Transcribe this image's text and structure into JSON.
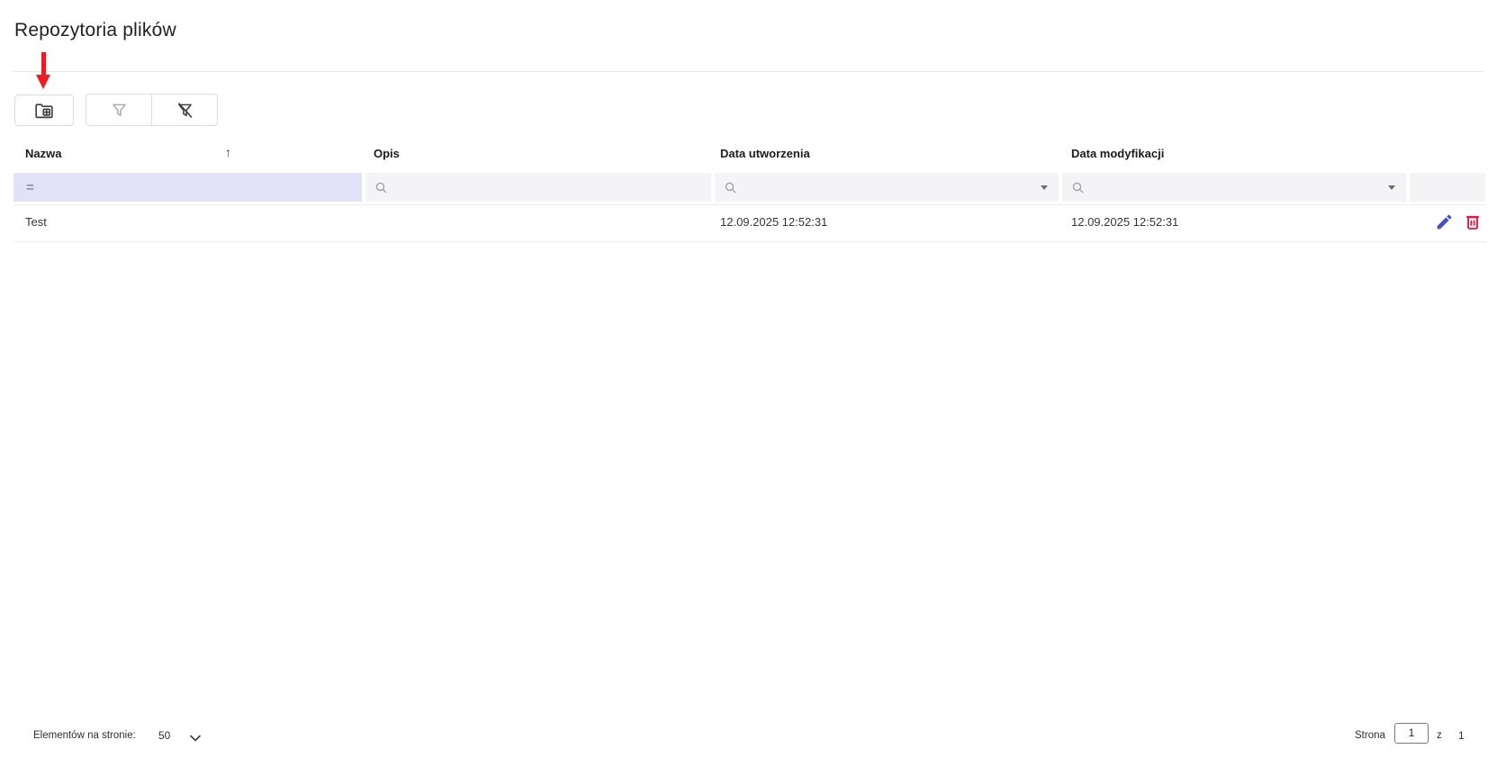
{
  "page": {
    "title": "Repozytoria plików"
  },
  "annotation": {
    "arrow_color": "#ec1c24",
    "arrow_points_to": "add-repository-button"
  },
  "toolbar": {
    "add_button_icon": "folder-plus",
    "filter_button_icon": "filter-funnel",
    "clear_filter_button_icon": "filter-funnel-off"
  },
  "table": {
    "columns": [
      {
        "label": "Nazwa",
        "sort": "asc",
        "filter": "equals"
      },
      {
        "label": "Opis",
        "filter": "search"
      },
      {
        "label": "Data utworzenia",
        "filter": "search-dropdown"
      },
      {
        "label": "Data modyfikacji",
        "filter": "search-dropdown"
      }
    ],
    "sort_icon_glyph": "↑",
    "equals_glyph": "=",
    "rows": [
      {
        "nazwa": "Test",
        "opis": "",
        "data_utworzenia": "12.09.2025 12:52:31",
        "data_modyfikacji": "12.09.2025 12:52:31"
      }
    ]
  },
  "pagination": {
    "items_per_page_label": "Elementów na stronie:",
    "items_per_page_value": "50",
    "page_label": "Strona",
    "current_page": "1",
    "of_label": "z",
    "total_pages": "1"
  },
  "colors": {
    "annotation_arrow": "#ec1c24",
    "edit_icon": "#4152c9",
    "delete_icon": "#dd1b47",
    "name_filter_bg": "#e2e1f7",
    "filter_bg": "#f4f4f6"
  }
}
